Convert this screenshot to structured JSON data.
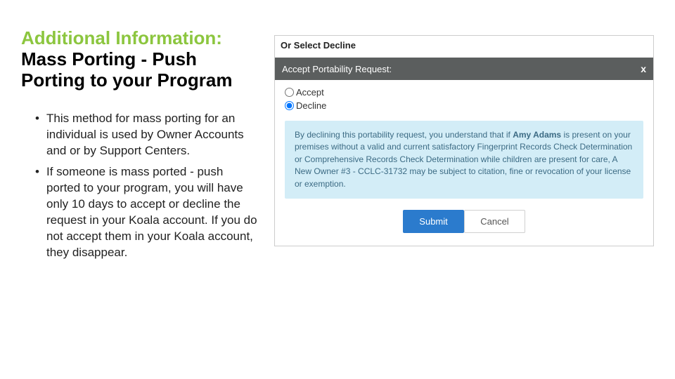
{
  "title": {
    "line1": "Additional Information:",
    "line2": "Mass Porting - Push Porting to your Program"
  },
  "bullets": [
    "This method for mass porting for an individual is used by Owner Accounts and or by Support Centers.",
    "If someone is mass ported - push ported to your program, you will have only 10 days to accept or decline the request in your Koala account. If you do not accept them in your Koala account, they disappear."
  ],
  "app": {
    "or_select_decline": "Or Select Decline",
    "modal_title": "Accept Portability Request:",
    "close_icon": "x",
    "option_accept": "Accept",
    "option_decline": "Decline",
    "decline_notice_prefix": "By declining this portability request, you understand that if ",
    "decline_notice_name": "Amy Adams",
    "decline_notice_suffix": " is present on your premises without a valid and current satisfactory Fingerprint Records Check Determination or Comprehensive Records Check Determination while children are present for care, A New Owner #3 - CCLC-31732 may be subject to citation, fine or revocation of your license or exemption.",
    "submit_label": "Submit",
    "cancel_label": "Cancel"
  }
}
